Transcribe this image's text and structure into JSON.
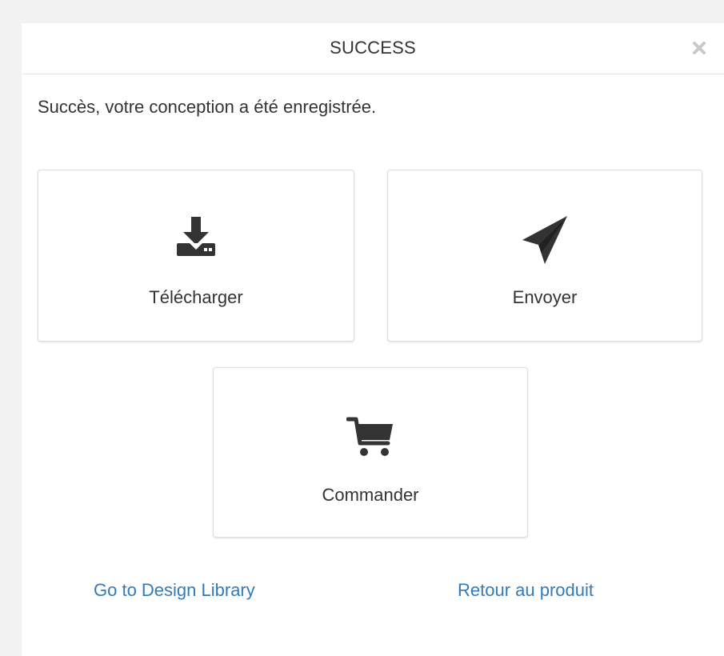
{
  "modal": {
    "title": "SUCCESS",
    "message": "Succès, votre conception a été enregistrée.",
    "accent_color": "#337ab7"
  },
  "actions": [
    {
      "label": "Télécharger",
      "icon": "download-icon"
    },
    {
      "label": "Envoyer",
      "icon": "paper-plane-icon"
    },
    {
      "label": "Commander",
      "icon": "shopping-cart-icon"
    }
  ],
  "links": {
    "design_library": "Go to Design Library",
    "back_to_product": "Retour au produit"
  },
  "icons": {
    "close": "close-icon"
  }
}
